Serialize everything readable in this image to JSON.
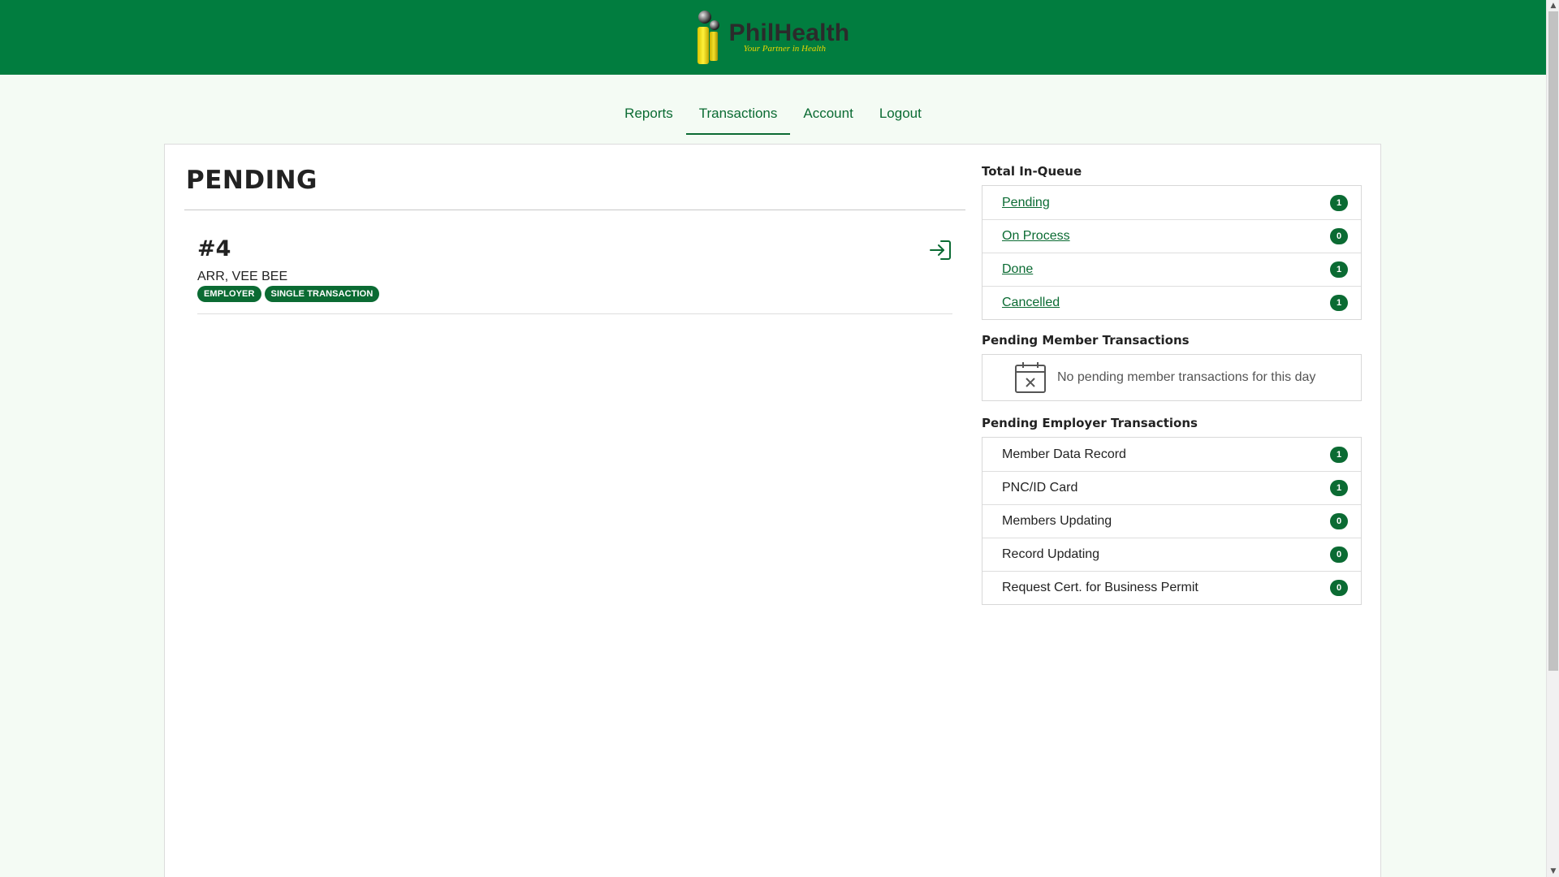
{
  "header": {
    "logo_name": "PhilHealth",
    "logo_tagline": "Your Partner in Health",
    "bar_color": "#017d3f"
  },
  "nav": {
    "items": [
      {
        "label": "Reports",
        "active": false
      },
      {
        "label": "Transactions",
        "active": true
      },
      {
        "label": "Account",
        "active": false
      },
      {
        "label": "Logout",
        "active": false
      }
    ]
  },
  "main": {
    "title": "PENDING",
    "entry": {
      "number": "#4",
      "name": "ARR, VEE BEE",
      "badges": [
        "EMPLOYER",
        "SINGLE TRANSACTION"
      ],
      "action_icon": "sign-in-icon"
    }
  },
  "sidebar": {
    "queue_title": "Total In-Queue",
    "queue": [
      {
        "label": "Pending",
        "count": "1"
      },
      {
        "label": "On Process",
        "count": "0"
      },
      {
        "label": "Done",
        "count": "1"
      },
      {
        "label": "Cancelled",
        "count": "1"
      }
    ],
    "member_title": "Pending Member Transactions",
    "member_empty_text": "No pending member transactions for this day",
    "member_empty_icon": "calendar-x-icon",
    "employer_title": "Pending Employer Transactions",
    "employer": [
      {
        "label": "Member Data Record",
        "count": "1"
      },
      {
        "label": "PNC/ID Card",
        "count": "1"
      },
      {
        "label": "Members Updating",
        "count": "0"
      },
      {
        "label": "Record Updating",
        "count": "0"
      },
      {
        "label": "Request Cert. for Business Permit",
        "count": "0"
      }
    ]
  },
  "colors": {
    "accent": "#0b6b33",
    "background": "#f4fbf4"
  }
}
